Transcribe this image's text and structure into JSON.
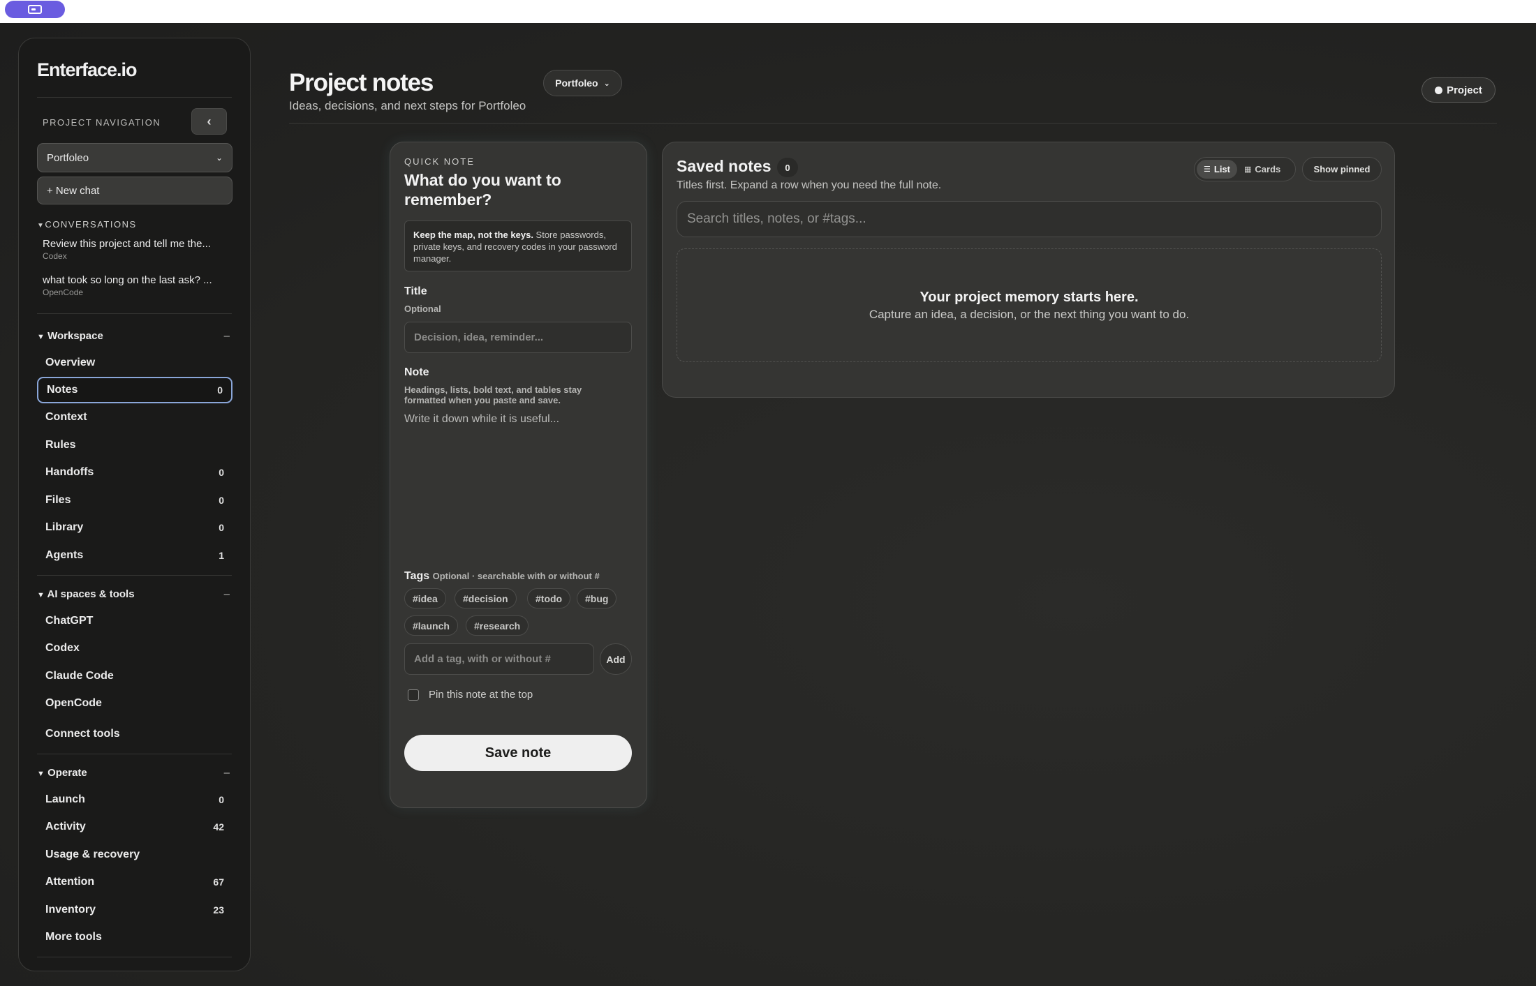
{
  "app": {
    "brand": "Enterface.io"
  },
  "sidebar": {
    "project_nav_label": "PROJECT NAVIGATION",
    "collapse_glyph": "‹",
    "project_select": "Portfoleo",
    "new_chat": "+ New chat",
    "conversations_header": "CONVERSATIONS",
    "conversations": [
      {
        "title": "Review this project and tell me the...",
        "source": "Codex"
      },
      {
        "title": "what took so long on the last ask? ...",
        "source": "OpenCode"
      }
    ],
    "groups": {
      "workspace": {
        "label": "Workspace",
        "toggle": "–",
        "items": [
          {
            "label": "Overview",
            "count": ""
          },
          {
            "label": "Notes",
            "count": "0"
          },
          {
            "label": "Context",
            "count": ""
          },
          {
            "label": "Rules",
            "count": ""
          },
          {
            "label": "Handoffs",
            "count": "0"
          },
          {
            "label": "Files",
            "count": "0"
          },
          {
            "label": "Library",
            "count": "0"
          },
          {
            "label": "Agents",
            "count": "1"
          }
        ]
      },
      "ai": {
        "label": "AI spaces & tools",
        "toggle": "–",
        "items": [
          {
            "label": "ChatGPT"
          },
          {
            "label": "Codex"
          },
          {
            "label": "Claude Code"
          },
          {
            "label": "OpenCode"
          },
          {
            "label": "Connect tools"
          }
        ]
      },
      "operate": {
        "label": "Operate",
        "toggle": "–",
        "items": [
          {
            "label": "Launch",
            "count": "0"
          },
          {
            "label": "Activity",
            "count": "42"
          },
          {
            "label": "Usage & recovery",
            "count": ""
          },
          {
            "label": "Attention",
            "count": "67"
          },
          {
            "label": "Inventory",
            "count": "23"
          },
          {
            "label": "More tools",
            "count": ""
          }
        ]
      }
    }
  },
  "header": {
    "title": "Project notes",
    "subtitle": "Ideas, decisions, and next steps for Portfoleo",
    "project_select": "Portfoleo",
    "badge": "Project"
  },
  "quick_note": {
    "kicker": "QUICK NOTE",
    "heading": "What do you want to remember?",
    "warning_bold": "Keep the map, not the keys.",
    "warning_text": " Store passwords, private keys, and recovery codes in your password manager.",
    "title_label": "Title",
    "title_hint": "Optional",
    "title_placeholder": "Decision, idea, reminder...",
    "note_label": "Note",
    "note_hint": "Headings, lists, bold text, and tables stay formatted when you paste and save.",
    "note_placeholder": "Write it down while it is useful...",
    "tags_label": "Tags",
    "tags_hint": "Optional · searchable with or without #",
    "tags": [
      "#idea",
      "#decision",
      "#todo",
      "#bug",
      "#launch",
      "#research"
    ],
    "tag_input_placeholder": "Add a tag, with or without #",
    "tag_add": "Add",
    "pin_label": "Pin this note at the top",
    "save_label": "Save note"
  },
  "saved_notes": {
    "title": "Saved notes",
    "count": "0",
    "subtitle": "Titles first. Expand a row when you need the full note.",
    "view_list": "List",
    "view_cards": "Cards",
    "show_pinned": "Show pinned",
    "search_placeholder": "Search titles, notes, or #tags...",
    "empty_title": "Your project memory starts here.",
    "empty_sub": "Capture an idea, a decision, or the next thing you want to do."
  },
  "colors": {
    "accent": "#6a5ce0",
    "active_outline": "#8aa6d8",
    "background": "#242422",
    "card": "#353533"
  },
  "icons": {
    "top_pill": "window-icon",
    "collapse": "chevron-left-icon",
    "dropdown": "chevron-down-icon",
    "list": "list-icon",
    "cards": "cards-icon",
    "badge": "dot-icon"
  }
}
